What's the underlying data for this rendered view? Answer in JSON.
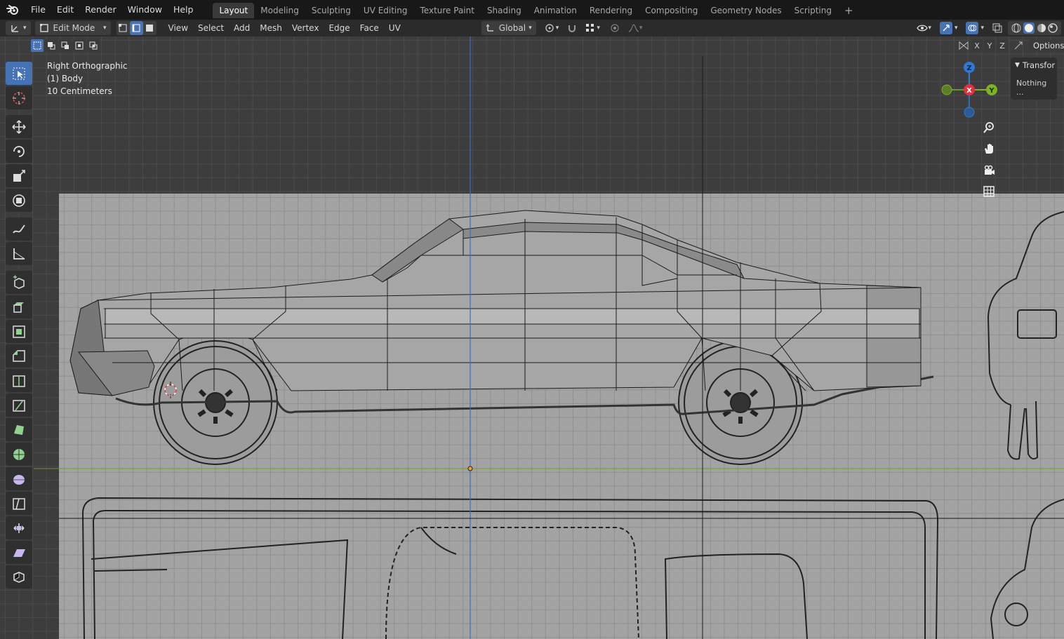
{
  "menubar": {
    "items": [
      "File",
      "Edit",
      "Render",
      "Window",
      "Help"
    ]
  },
  "workspaces": {
    "tabs": [
      "Layout",
      "Modeling",
      "Sculpting",
      "UV Editing",
      "Texture Paint",
      "Shading",
      "Animation",
      "Rendering",
      "Compositing",
      "Geometry Nodes",
      "Scripting"
    ],
    "active": "Layout",
    "add_label": "+"
  },
  "header": {
    "mode": "Edit Mode",
    "menus": [
      "View",
      "Select",
      "Add",
      "Mesh",
      "Vertex",
      "Edge",
      "Face",
      "UV"
    ],
    "orientation": "Global"
  },
  "viewport": {
    "info_lines": [
      "Right Orthographic",
      "(1) Body",
      "10 Centimeters"
    ]
  },
  "gizmo": {
    "x": "X",
    "y": "Y",
    "z": "Z"
  },
  "axis_toggles": [
    "X",
    "Y",
    "Z"
  ],
  "options_label": "Options",
  "npanel": {
    "section": "Transfor",
    "text": "Nothing ..."
  },
  "colors": {
    "accent": "#4772b3",
    "x_axis": "#e0323e",
    "y_axis": "#7cb223",
    "z_axis": "#2f7ad3"
  }
}
